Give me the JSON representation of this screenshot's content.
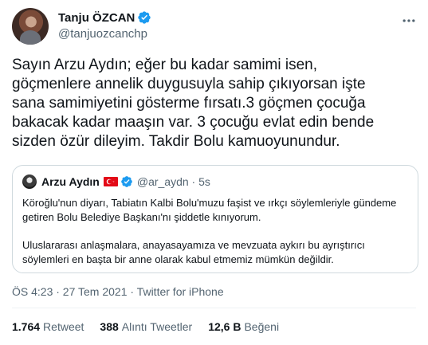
{
  "tweet": {
    "display_name": "Tanju ÖZCAN",
    "handle": "@tanjuozcanchp",
    "verified_icon": "verified-badge-icon",
    "more_icon": "more-icon",
    "text": "Sayın Arzu Aydın; eğer bu kadar samimi isen,\ngöçmenlere annelik duygusuyla sahip çıkıyorsan işte\nsana samimiyetini gösterme fırsatı.3 göçmen çocuğa\nbakacak kadar maaşın var. 3 çocuğu evlat edin bende\nsizden özür dileyim. Takdir Bolu kamuoyunundur.",
    "timestamp": "ÖS 4:23 · 27 Tem 2021 · Twitter for iPhone"
  },
  "quote": {
    "display_name": "Arzu Aydın",
    "flag_icon": "turkey-flag-icon",
    "handle_time": "@ar_aydn · 5s",
    "paragraph1": "Köroğlu'nun diyarı, Tabiatın Kalbi Bolu'muzu faşist ve ırkçı söylemleriyle gündeme getiren Bolu Belediye Başkanı'nı şiddetle kınıyorum.",
    "paragraph2": "Uluslararası anlaşmalara, anayasayamıza ve mevzuata aykırı bu ayrıştırıcı söylemleri en başta bir anne olarak kabul etmemiz mümkün değildir."
  },
  "stats": {
    "retweets_count": "1.764",
    "retweets_label": "Retweet",
    "quotes_count": "388",
    "quotes_label": "Alıntı Tweetler",
    "likes_count": "12,6 B",
    "likes_label": "Beğeni"
  },
  "colors": {
    "verified_blue": "#1d9bf0",
    "muted_text": "#536471",
    "border": "#cfd9de",
    "flag_red": "#e30a17"
  }
}
